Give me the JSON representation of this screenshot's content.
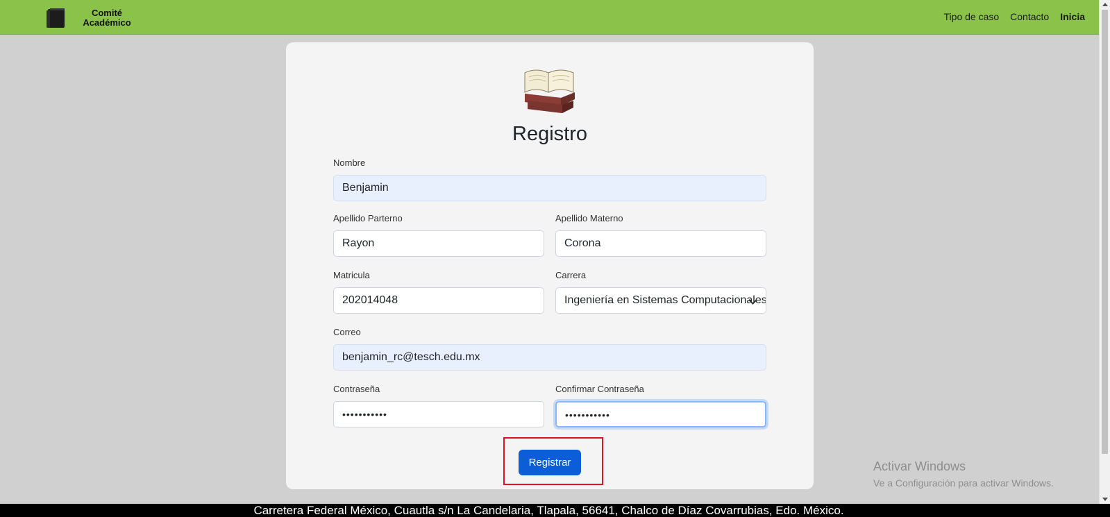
{
  "navbar": {
    "brand_line1": "Comité",
    "brand_line2": "Académico",
    "links": [
      "Tipo de caso",
      "Contacto",
      "Inicia"
    ]
  },
  "form": {
    "title": "Registro",
    "nombre_label": "Nombre",
    "nombre_value": "Benjamin",
    "apellido_paterno_label": "Apellido Parterno",
    "apellido_paterno_value": "Rayon",
    "apellido_materno_label": "Apellido Materno",
    "apellido_materno_value": "Corona",
    "matricula_label": "Matricula",
    "matricula_value": "202014048",
    "carrera_label": "Carrera",
    "carrera_value": "Ingeniería en Sistemas Computacionales",
    "correo_label": "Correo",
    "correo_value": "benjamin_rc@tesch.edu.mx",
    "contrasena_label": "Contraseña",
    "contrasena_value": "•••••••••••",
    "confirmar_label": "Confirmar Contraseña",
    "confirmar_value": "•••••••••••",
    "submit_label": "Registrar"
  },
  "watermark": {
    "line1": "Activar Windows",
    "line2": "Ve a Configuración para activar Windows."
  },
  "footer": {
    "address": "Carretera Federal México, Cuautla s/n La Candelaria, Tlapala, 56641, Chalco de Díaz Covarrubias, Edo. México."
  },
  "colors": {
    "navbar": "#8bc34a",
    "button": "#0b5ed7",
    "highlight": "#e0141e"
  }
}
